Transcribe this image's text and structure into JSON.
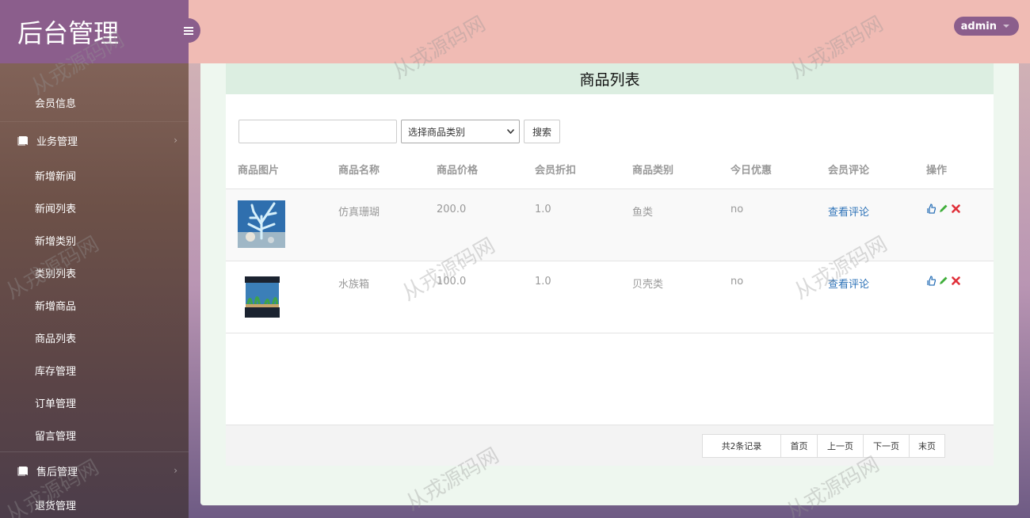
{
  "sidebar": {
    "logo": "后台管理",
    "top_item": "会员信息",
    "groups": [
      {
        "label": "业务管理",
        "items": [
          "新增新闻",
          "新闻列表",
          "新增类别",
          "类别列表",
          "新增商品",
          "商品列表",
          "库存管理",
          "订单管理",
          "留言管理"
        ]
      },
      {
        "label": "售后管理",
        "items": [
          "退货管理"
        ]
      }
    ]
  },
  "header": {
    "user": "admin"
  },
  "main": {
    "title": "商品列表",
    "search": {
      "input_value": "",
      "category_select": "选择商品类别",
      "button": "搜索"
    },
    "table": {
      "columns": [
        "商品图片",
        "商品名称",
        "商品价格",
        "会员折扣",
        "商品类别",
        "今日优惠",
        "会员评论",
        "操作"
      ],
      "rows": [
        {
          "image": "coral-image",
          "name": "仿真珊瑚",
          "price": "200.0",
          "discount": "1.0",
          "category": "鱼类",
          "today": "no",
          "comment": "查看评论"
        },
        {
          "image": "aquarium-image",
          "name": "水族箱",
          "price": "100.0",
          "discount": "1.0",
          "category": "贝壳类",
          "today": "no",
          "comment": "查看评论"
        }
      ]
    },
    "pagination": {
      "total": "共2条记录",
      "first": "首页",
      "prev": "上一页",
      "next": "下一页",
      "last": "末页"
    }
  },
  "watermark": "从戎源码网",
  "colors": {
    "sidebar_brand": "#8b5e8c",
    "header_bg": "#f0bbb4",
    "title_bar": "#dceee1",
    "link": "#2e73b8",
    "delete": "#e0303a",
    "edit": "#3fae3a"
  }
}
